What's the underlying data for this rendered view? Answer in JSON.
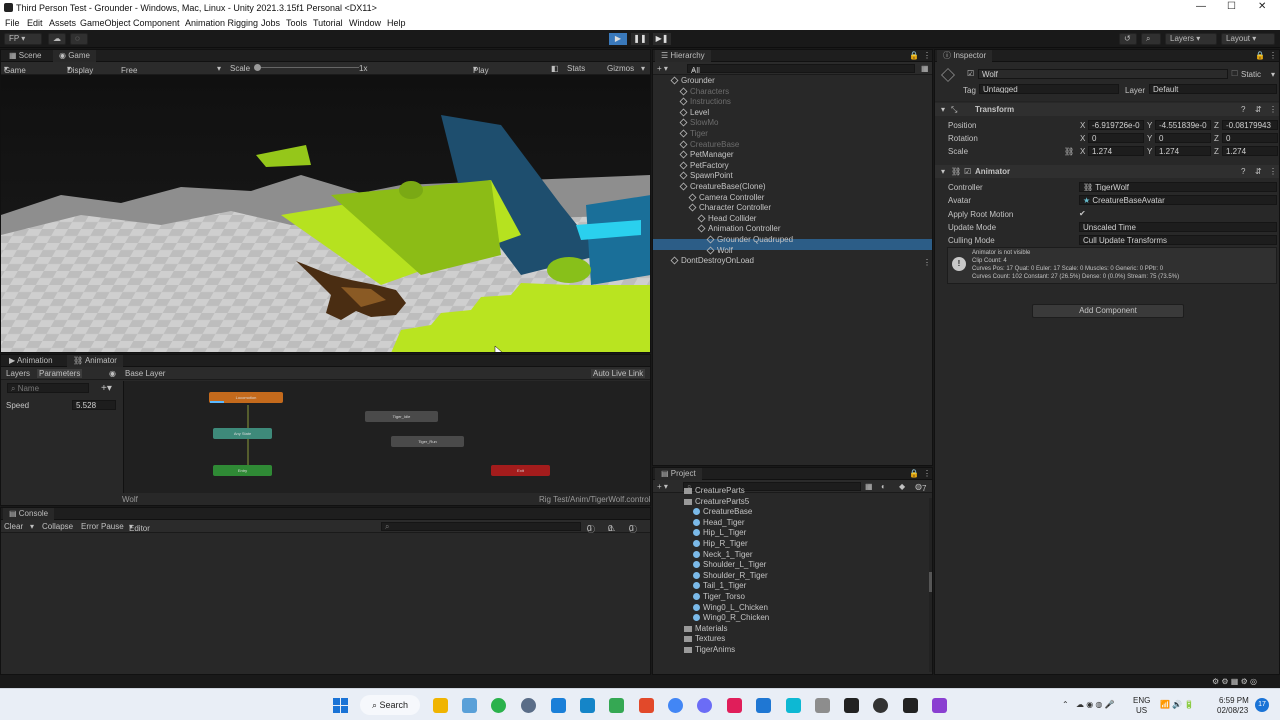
{
  "window": {
    "title": "Third Person Test - Grounder - Windows, Mac, Linux - Unity 2021.3.15f1 Personal <DX11>",
    "min": "—",
    "max": "☐",
    "close": "✕"
  },
  "menu": [
    "File",
    "Edit",
    "Assets",
    "GameObject",
    "Component",
    "Animation Rigging",
    "Jobs",
    "Tools",
    "Tutorial",
    "Window",
    "Help"
  ],
  "toolbar": {
    "account": "FP",
    "layers": "Layers",
    "layout": "Layout"
  },
  "scene_panel": {
    "tabs": [
      "Scene",
      "Game"
    ],
    "game_dropdown": "Game",
    "display": "Display 1",
    "aspect": "Free Aspect",
    "scale_label": "Scale",
    "scale_value": "1x",
    "play_focused": "Play Focused",
    "stats": "Stats",
    "gizmos": "Gizmos"
  },
  "animator_panel": {
    "tabs": [
      "Animation",
      "Animator"
    ],
    "left_tabs": [
      "Layers",
      "Parameters"
    ],
    "search_placeholder": "Name",
    "base_layer": "Base Layer",
    "auto_live_link": "Auto Live Link",
    "param_name": "Speed",
    "param_value": "5.528",
    "nodes": [
      "Locomotion",
      "Any State",
      "Entry",
      "Tiger_Idle",
      "Tiger_Run",
      "Exit"
    ],
    "footer_left": "Wolf",
    "footer_right": "Rig Test/Anim/TigerWolf.controller"
  },
  "console_panel": {
    "tab": "Console",
    "clear": "Clear",
    "collapse": "Collapse",
    "error_pause": "Error Pause",
    "editor": "Editor",
    "counts": [
      "0",
      "0",
      "0"
    ]
  },
  "hierarchy": {
    "tab": "Hierarchy",
    "search_placeholder": "All",
    "items": [
      {
        "label": "Grounder",
        "indent": 0,
        "dim": false,
        "icon": "unity"
      },
      {
        "label": "Characters",
        "indent": 1,
        "dim": true,
        "icon": "cube"
      },
      {
        "label": "Instructions",
        "indent": 1,
        "dim": true,
        "icon": "cube"
      },
      {
        "label": "Level",
        "indent": 1,
        "dim": false,
        "icon": "cube"
      },
      {
        "label": "SlowMo",
        "indent": 1,
        "dim": true,
        "icon": "cube"
      },
      {
        "label": "Tiger",
        "indent": 1,
        "dim": true,
        "icon": "cube"
      },
      {
        "label": "CreatureBase",
        "indent": 1,
        "dim": true,
        "icon": "cube"
      },
      {
        "label": "PetManager",
        "indent": 1,
        "dim": false,
        "icon": "cube"
      },
      {
        "label": "PetFactory",
        "indent": 1,
        "dim": false,
        "icon": "cube"
      },
      {
        "label": "SpawnPoint",
        "indent": 1,
        "dim": false,
        "icon": "cube"
      },
      {
        "label": "CreatureBase(Clone)",
        "indent": 1,
        "dim": false,
        "icon": "cube"
      },
      {
        "label": "Camera Controller",
        "indent": 2,
        "dim": false,
        "icon": "cube"
      },
      {
        "label": "Character Controller",
        "indent": 2,
        "dim": false,
        "icon": "cube"
      },
      {
        "label": "Head Collider",
        "indent": 3,
        "dim": false,
        "icon": "cube"
      },
      {
        "label": "Animation Controller",
        "indent": 3,
        "dim": false,
        "icon": "cube"
      },
      {
        "label": "Grounder Quadruped",
        "indent": 4,
        "dim": false,
        "icon": "cube"
      },
      {
        "label": "Wolf",
        "indent": 4,
        "dim": false,
        "icon": "cube"
      },
      {
        "label": "DontDestroyOnLoad",
        "indent": 0,
        "dim": false,
        "icon": "unity"
      }
    ]
  },
  "project": {
    "tab": "Project",
    "count": "7",
    "items": [
      {
        "label": "CreatureParts",
        "indent": 1,
        "icon": "fold"
      },
      {
        "label": "CreatureParts5",
        "indent": 1,
        "icon": "fold"
      },
      {
        "label": "CreatureBase",
        "indent": 2,
        "icon": "man"
      },
      {
        "label": "Head_Tiger",
        "indent": 2,
        "icon": "man"
      },
      {
        "label": "Hip_L_Tiger",
        "indent": 2,
        "icon": "man"
      },
      {
        "label": "Hip_R_Tiger",
        "indent": 2,
        "icon": "man"
      },
      {
        "label": "Neck_1_Tiger",
        "indent": 2,
        "icon": "man"
      },
      {
        "label": "Shoulder_L_Tiger",
        "indent": 2,
        "icon": "man"
      },
      {
        "label": "Shoulder_R_Tiger",
        "indent": 2,
        "icon": "man"
      },
      {
        "label": "Tail_1_Tiger",
        "indent": 2,
        "icon": "man"
      },
      {
        "label": "Tiger_Torso",
        "indent": 2,
        "icon": "man"
      },
      {
        "label": "Wing0_L_Chicken",
        "indent": 2,
        "icon": "man"
      },
      {
        "label": "Wing0_R_Chicken",
        "indent": 2,
        "icon": "man"
      },
      {
        "label": "Materials",
        "indent": 1,
        "icon": "fold"
      },
      {
        "label": "Textures",
        "indent": 1,
        "icon": "fold"
      },
      {
        "label": "TigerAnims",
        "indent": 1,
        "icon": "fold"
      }
    ]
  },
  "inspector": {
    "tab": "Inspector",
    "object_name": "Wolf",
    "static": "Static",
    "tag_label": "Tag",
    "tag_value": "Untagged",
    "layer_label": "Layer",
    "layer_value": "Default",
    "transform": {
      "title": "Transform",
      "position_label": "Position",
      "rotation_label": "Rotation",
      "scale_label": "Scale",
      "pos": [
        "-6.919726e-0",
        "-4.551839e-0",
        "-0.08179943"
      ],
      "rot": [
        "0",
        "0",
        "0"
      ],
      "scl": [
        "1.274",
        "1.274",
        "1.274"
      ]
    },
    "animator": {
      "title": "Animator",
      "controller_label": "Controller",
      "controller_value": "TigerWolf",
      "avatar_label": "Avatar",
      "avatar_value": "CreatureBaseAvatar",
      "root_motion_label": "Apply Root Motion",
      "update_mode_label": "Update Mode",
      "update_mode_value": "Unscaled Time",
      "culling_mode_label": "Culling Mode",
      "culling_mode_value": "Cull Update Transforms",
      "info": [
        "Animator is not visible",
        "Clip Count: 4",
        "Curves Pos: 17 Quat: 0 Euler: 17 Scale: 0 Muscles: 0 Generic: 0 PPtr: 0",
        "Curves Count: 102 Constant: 27 (26.5%) Dense: 0 (0.0%) Stream: 75 (73.5%)"
      ]
    },
    "add_component": "Add Component"
  },
  "taskbar": {
    "search": "Search",
    "lang1": "ENG",
    "lang2": "US",
    "time": "6:59 PM",
    "date": "02/08/23",
    "notif": "17"
  },
  "colors": {
    "accent": "#3a79bb",
    "lime": "#a6d61e"
  }
}
